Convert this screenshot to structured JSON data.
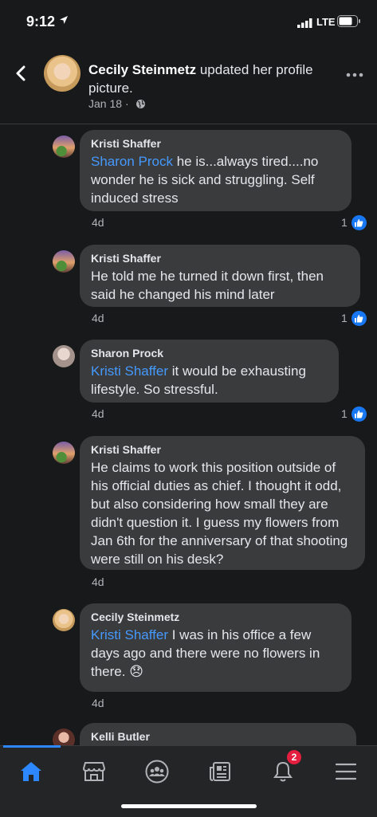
{
  "status_bar": {
    "time": "9:12",
    "network": "LTE"
  },
  "post": {
    "author": "Cecily Steinmetz",
    "action": "updated her profile picture.",
    "date": "Jan 18",
    "separator": "·"
  },
  "comments": [
    {
      "name": "Kristi Shaffer",
      "mention": "Sharon Prock",
      "text": " he is...always tired....no wonder he is sick and struggling.  Self induced stress",
      "time": "4d",
      "likes": "1"
    },
    {
      "name": "Kristi Shaffer",
      "mention": "",
      "text": "He told me he turned it down first, then said he changed his mind later",
      "time": "4d",
      "likes": "1"
    },
    {
      "name": "Sharon Prock",
      "mention": "Kristi Shaffer",
      "text": " it would be exhausting lifestyle. So stressful.",
      "time": "4d",
      "likes": "1"
    },
    {
      "name": "Kristi Shaffer",
      "mention": "",
      "text": "He claims to work this position outside of his official duties as chief.  I thought it odd, but also considering how small they are didn't question it. I guess my flowers from Jan 6th for the anniversary of that shooting were still on his desk?",
      "time": "4d",
      "likes": ""
    },
    {
      "name": "Cecily Steinmetz",
      "mention": "Kristi Shaffer",
      "text": " I was in his office a few days ago and there were no flowers in there. 😞",
      "time": "4d",
      "likes": ""
    },
    {
      "name": "Kelli Butler",
      "mention": "",
      "text": "",
      "time": "",
      "likes": ""
    }
  ],
  "tab_bar": {
    "tabs": [
      "home-icon",
      "marketplace-icon",
      "groups-icon",
      "news-icon",
      "notifications-icon",
      "menu-icon"
    ],
    "notifications_badge": "2",
    "accent": "#2d88ff"
  },
  "colors": {
    "background": "#18191a",
    "bubble": "#3a3b3c",
    "mention": "#4599ff",
    "like": "#1877f2",
    "badge": "#e41e3f"
  }
}
